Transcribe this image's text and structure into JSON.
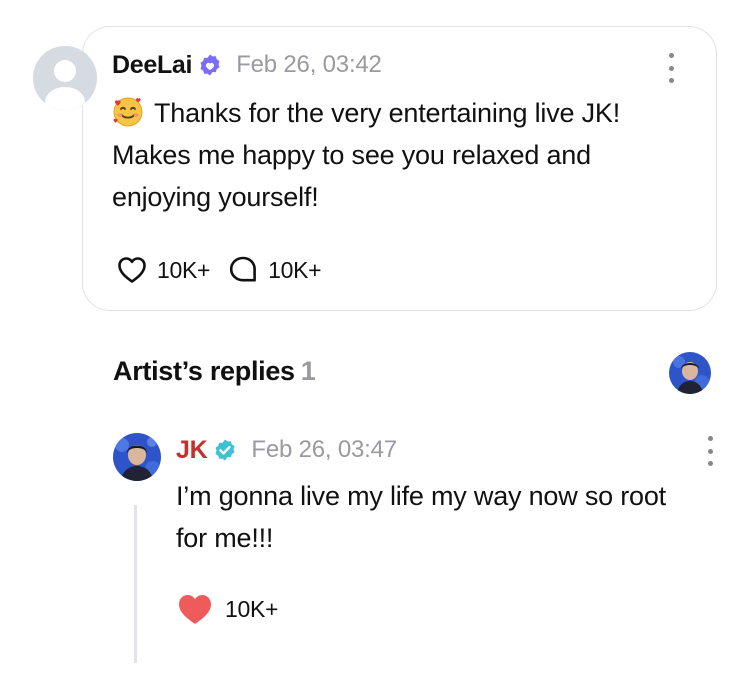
{
  "comment": {
    "author": "DeeLai",
    "timestamp": "Feb 26, 03:42",
    "text": "Thanks for the very entertaining live JK!  Makes me happy to see you relaxed and enjoying yourself!",
    "emoji": "smiling-face-with-hearts",
    "likes": "10K+",
    "replies": "10K+"
  },
  "artist_replies": {
    "title": "Artist’s replies",
    "count": "1",
    "reply": {
      "author": "JK",
      "timestamp": "Feb 26, 03:47",
      "text": "I’m gonna live my life my way now so root for me!!!",
      "likes": "10K+",
      "liked": true
    }
  },
  "colors": {
    "artist_name": "#c4302b",
    "verified_fan": "#7b6cf6",
    "verified_artist": "#3ec1d3",
    "liked_heart": "#ef5b5b",
    "muted_text": "#9a9aa0"
  },
  "icons": [
    "verified-badge-icon",
    "more-options-icon",
    "heart-outline-icon",
    "comment-bubble-icon",
    "heart-filled-icon"
  ]
}
